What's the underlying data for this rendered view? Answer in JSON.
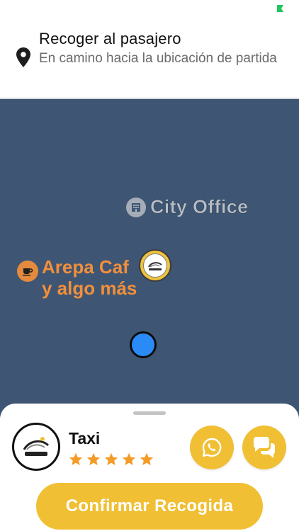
{
  "status_bar": {
    "indicator_color": "#22c55e"
  },
  "header": {
    "icon": "location-pin-icon",
    "title": "Recoger al pasajero",
    "subtitle": "En camino hacia la ubicación de partida"
  },
  "map": {
    "background_color": "#3e5674",
    "pois": [
      {
        "label": "City Office",
        "icon": "building-icon"
      },
      {
        "label_line1": "Arepa Caf",
        "label_line2": "y algo más",
        "icon": "coffee-cup-icon"
      }
    ],
    "driver_marker": {
      "icon": "taxi-logo-icon"
    },
    "user_marker": {
      "icon": "current-location-dot",
      "color": "#2a8af6"
    }
  },
  "driver_panel": {
    "avatar_icon": "taxi-logo-icon",
    "name": "Taxi",
    "rating": 5,
    "rating_max": 5,
    "star_color": "#f39c28",
    "whatsapp_icon": "whatsapp-icon",
    "chat_icon": "chat-bubbles-icon",
    "confirm_label": "Confirmar Recogida",
    "accent_color": "#f0bf34"
  }
}
